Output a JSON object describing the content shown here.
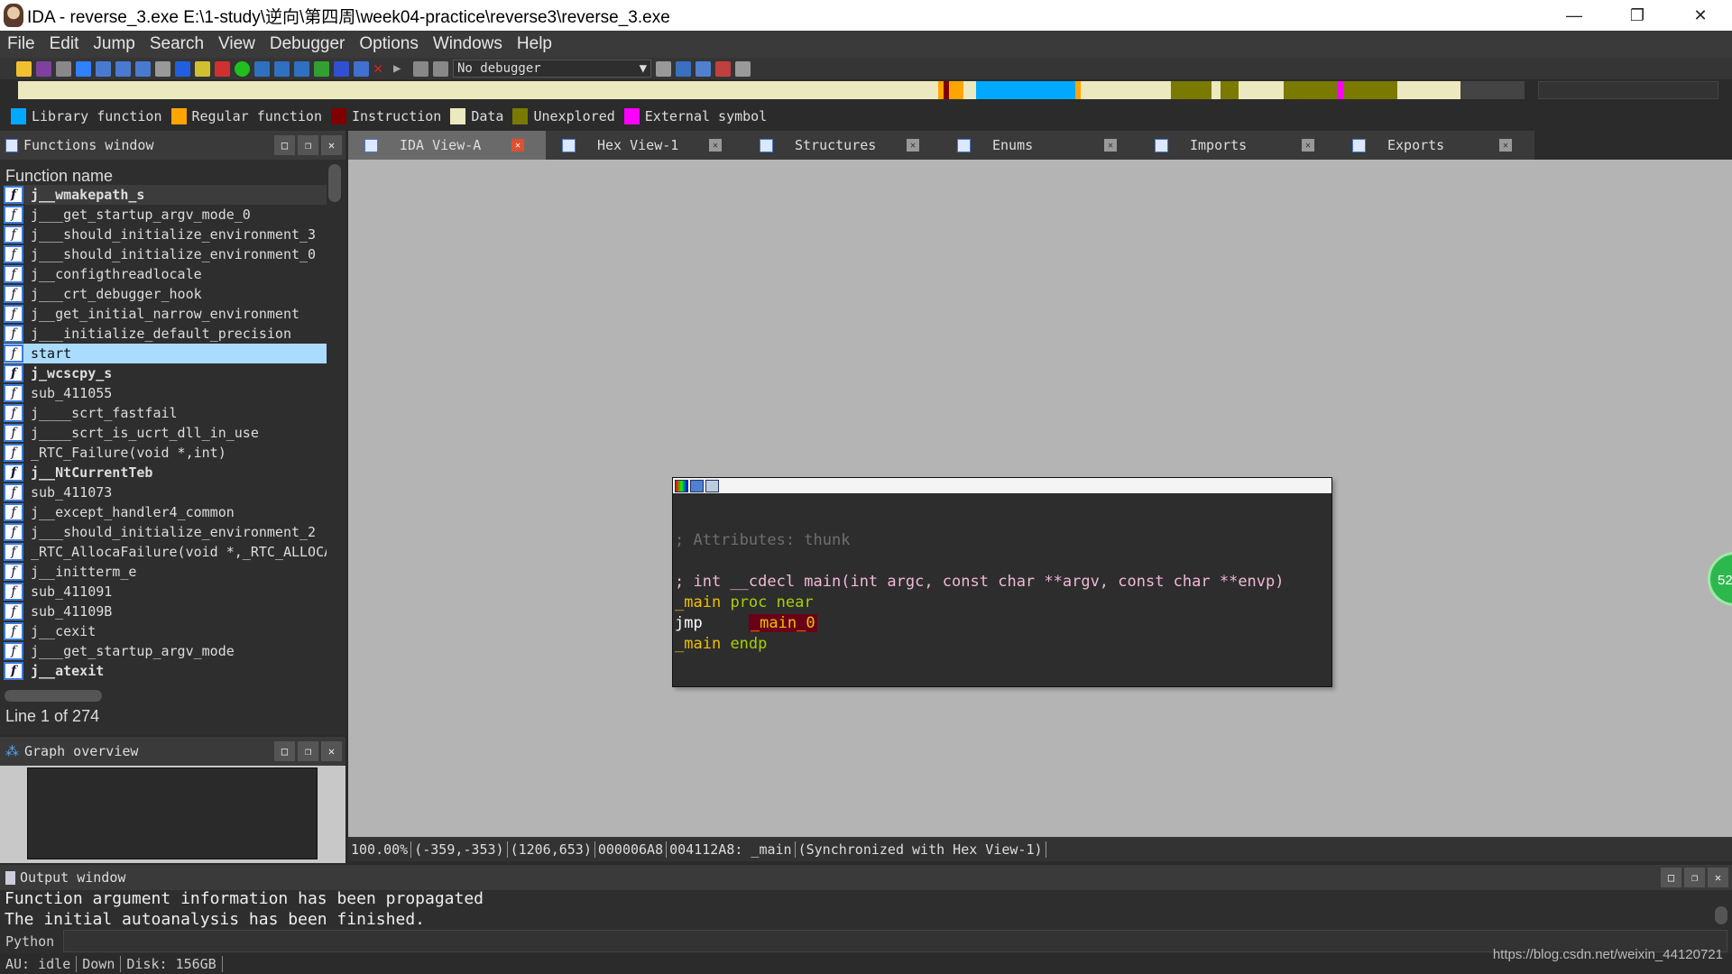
{
  "window": {
    "title": "IDA - reverse_3.exe E:\\1-study\\逆向\\第四周\\week04-practice\\reverse3\\reverse_3.exe"
  },
  "menu": [
    "File",
    "Edit",
    "Jump",
    "Search",
    "View",
    "Debugger",
    "Options",
    "Windows",
    "Help"
  ],
  "toolbar": {
    "debugger": "No debugger"
  },
  "legend": [
    {
      "label": "Library function",
      "color": "#00a8ff"
    },
    {
      "label": "Regular function",
      "color": "#ffa500"
    },
    {
      "label": "Instruction",
      "color": "#800000"
    },
    {
      "label": "Data",
      "color": "#ece8c0"
    },
    {
      "label": "Unexplored",
      "color": "#7a7a00"
    },
    {
      "label": "External symbol",
      "color": "#ff00ff"
    }
  ],
  "functions_window": {
    "title": "Functions window",
    "column": "Function name",
    "line_info": "Line 1 of 274",
    "items": [
      {
        "name": "j__wmakepath_s",
        "bold": true
      },
      {
        "name": "j___get_startup_argv_mode_0"
      },
      {
        "name": "j___should_initialize_environment_3"
      },
      {
        "name": "j___should_initialize_environment_0"
      },
      {
        "name": "j__configthreadlocale"
      },
      {
        "name": "j___crt_debugger_hook"
      },
      {
        "name": "j__get_initial_narrow_environment"
      },
      {
        "name": "j___initialize_default_precision"
      },
      {
        "name": "start",
        "selected": true
      },
      {
        "name": "j_wcscpy_s",
        "bold": true
      },
      {
        "name": "sub_411055"
      },
      {
        "name": "j____scrt_fastfail"
      },
      {
        "name": "j____scrt_is_ucrt_dll_in_use"
      },
      {
        "name": "_RTC_Failure(void *,int)"
      },
      {
        "name": "j__NtCurrentTeb",
        "bold": true
      },
      {
        "name": "sub_411073"
      },
      {
        "name": "j__except_handler4_common"
      },
      {
        "name": "j___should_initialize_environment_2"
      },
      {
        "name": "_RTC_AllocaFailure(void *,_RTC_ALLOCA_NODE *,int)"
      },
      {
        "name": "j__initterm_e"
      },
      {
        "name": "sub_411091"
      },
      {
        "name": "sub_41109B"
      },
      {
        "name": "j__cexit"
      },
      {
        "name": "j___get_startup_argv_mode"
      },
      {
        "name": "j__atexit",
        "bold": true
      }
    ]
  },
  "graph_overview": {
    "title": "Graph overview"
  },
  "tabs": [
    {
      "label": "IDA View-A",
      "active": true
    },
    {
      "label": "Hex View-1"
    },
    {
      "label": "Structures"
    },
    {
      "label": "Enums"
    },
    {
      "label": "Imports"
    },
    {
      "label": "Exports"
    }
  ],
  "code": {
    "comment": "; Attributes: thunk",
    "proto": "; int __cdecl main(int argc, const char **argv, const char **envp)",
    "l1_label": "_main",
    "l1_kw": "proc near",
    "l2_ins": "jmp",
    "l2_target": "_main_0",
    "l3_label": "_main",
    "l3_kw": "endp"
  },
  "overlay_badge": "52",
  "status": [
    "100.00%",
    "(-359,-353)",
    "(1206,653)",
    "000006A8",
    "004112A8: _main",
    "(Synchronized with Hex View-1)"
  ],
  "output": {
    "title": "Output window",
    "lines": "Function argument information has been propagated\nThe initial autoanalysis has been finished.",
    "python_label": "Python"
  },
  "bottom": [
    "AU:  idle",
    "Down",
    "Disk: 156GB"
  ],
  "watermark": "https://blog.csdn.net/weixin_44120721"
}
